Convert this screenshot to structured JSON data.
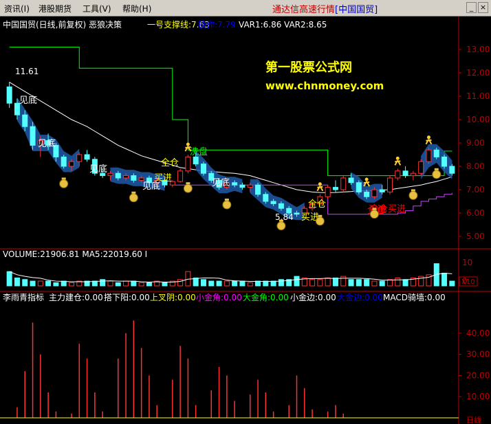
{
  "menu": {
    "items": [
      "资讯(I)",
      "港股期货",
      "工具(V)",
      "帮助(H)"
    ],
    "app_title_prefix": "通达信高速行情",
    "app_title_bracket": "[中国国贸]"
  },
  "window_controls": {
    "minimize": "_",
    "close": "×"
  },
  "price_panel": {
    "header": {
      "stock_title": "中国国贸(日线,前复权) 恶狼决策",
      "support_label": "一号支撑线:7.63",
      "operate_label": "操作:7.79",
      "var1_label": "VAR1:6.86",
      "var2_label": "VAR2:8.65"
    },
    "watermark_cn": "第一股票公式网",
    "watermark_url": "www.chnmoney.com",
    "annotations": {
      "price_high_mark": "11.61",
      "price_low_mark": "5.84",
      "signals": [
        {
          "text": "见底",
          "color": "#ffffff"
        },
        {
          "text": "见底",
          "color": "#ffffff"
        },
        {
          "text": "见底",
          "color": "#ffffff"
        },
        {
          "text": "见底",
          "color": "#ffffff"
        },
        {
          "text": "见底",
          "color": "#ffffff"
        },
        {
          "text": "全仓",
          "color": "#ffff00"
        },
        {
          "text": "买进",
          "color": "#ffff00"
        },
        {
          "text": "洗盘",
          "color": "#00ff00"
        },
        {
          "text": "全仓",
          "color": "#ffff00"
        },
        {
          "text": "买进",
          "color": "#ffff00"
        },
        {
          "text": "全仓",
          "color": "#ff0000"
        },
        {
          "text": "买进",
          "color": "#ff0000"
        },
        {
          "text": "全仓买进",
          "color": "#ff0000"
        }
      ]
    },
    "axis_ticks": [
      "13.00",
      "12.00",
      "11.00",
      "10.00",
      "9.00",
      "8.00",
      "7.00",
      "6.00",
      "5.00"
    ]
  },
  "volume_panel": {
    "header": "VOLUME:21906.81  MA5:22019.60 I",
    "axis_ticks": [
      "10",
      "0"
    ],
    "unit_label": "X10"
  },
  "indicator_panel": {
    "header_name": "李雨青指标",
    "items": [
      {
        "text": "主力建仓:0.00",
        "color": "#ffffff"
      },
      {
        "text": "搭下阳:0.00",
        "color": "#ffffff"
      },
      {
        "text": "上叉阴:0.00",
        "color": "#ffff00"
      },
      {
        "text": "小金角:0.00",
        "color": "#ff00ff"
      },
      {
        "text": "大金角:0.00",
        "color": "#00ff00"
      },
      {
        "text": "小金边:0.00",
        "color": "#ffffff"
      },
      {
        "text": "大金边:0.00",
        "color": "#0000ff"
      },
      {
        "text": "MACD骑墙:0.00",
        "color": "#ffffff"
      }
    ],
    "axis_ticks": [
      "40.00",
      "30.00",
      "20.00",
      "10.00"
    ],
    "bottom_label": "日线"
  },
  "chart_data": [
    {
      "type": "candlestick",
      "title": "中国国贸(日线,前复权) 恶狼决策",
      "y_range": [
        4.6,
        13.3
      ],
      "y_ticks": [
        13,
        12,
        11,
        10,
        9,
        8,
        7,
        6,
        5
      ],
      "candles_ohlc": [
        [
          11.4,
          11.61,
          10.5,
          10.7
        ],
        [
          10.7,
          10.9,
          10.0,
          10.2
        ],
        [
          10.2,
          10.4,
          9.5,
          9.7
        ],
        [
          9.7,
          9.9,
          8.7,
          8.9
        ],
        [
          8.9,
          9.3,
          8.4,
          9.1
        ],
        [
          9.1,
          9.4,
          8.7,
          8.9
        ],
        [
          8.9,
          9.0,
          8.2,
          8.4
        ],
        [
          8.4,
          8.5,
          7.9,
          8.0
        ],
        [
          8.0,
          8.3,
          7.8,
          8.2
        ],
        [
          8.2,
          8.6,
          8.0,
          8.5
        ],
        [
          8.5,
          8.7,
          8.2,
          8.3
        ],
        [
          8.3,
          8.4,
          7.6,
          7.7
        ],
        [
          7.7,
          7.9,
          7.5,
          7.6
        ],
        [
          7.6,
          7.8,
          7.4,
          7.7
        ],
        [
          7.7,
          7.8,
          7.4,
          7.5
        ],
        [
          7.5,
          7.7,
          7.4,
          7.6
        ],
        [
          7.6,
          7.7,
          7.3,
          7.4
        ],
        [
          7.4,
          7.6,
          7.3,
          7.5
        ],
        [
          7.5,
          7.6,
          7.2,
          7.3
        ],
        [
          7.3,
          7.5,
          7.2,
          7.4
        ],
        [
          7.4,
          7.5,
          7.1,
          7.2
        ],
        [
          7.2,
          7.4,
          7.1,
          7.35
        ],
        [
          7.35,
          7.9,
          7.3,
          7.8
        ],
        [
          7.8,
          8.5,
          7.7,
          8.4
        ],
        [
          8.4,
          8.6,
          8.0,
          8.1
        ],
        [
          8.1,
          8.2,
          7.6,
          7.7
        ],
        [
          7.7,
          7.8,
          7.3,
          7.4
        ],
        [
          7.4,
          7.5,
          7.0,
          7.1
        ],
        [
          7.1,
          7.4,
          7.0,
          7.3
        ],
        [
          7.3,
          7.4,
          7.1,
          7.2
        ],
        [
          7.2,
          7.3,
          7.0,
          7.1
        ],
        [
          7.1,
          7.3,
          6.9,
          7.2
        ],
        [
          7.2,
          7.3,
          6.7,
          6.8
        ],
        [
          6.8,
          6.9,
          6.4,
          6.5
        ],
        [
          6.5,
          6.6,
          6.3,
          6.4
        ],
        [
          6.4,
          6.5,
          6.1,
          6.2
        ],
        [
          6.2,
          6.3,
          5.9,
          6.0
        ],
        [
          6.0,
          6.1,
          5.84,
          5.95
        ],
        [
          5.95,
          6.3,
          5.9,
          6.2
        ],
        [
          6.2,
          6.5,
          6.1,
          6.4
        ],
        [
          6.4,
          6.8,
          6.3,
          6.7
        ],
        [
          6.7,
          7.2,
          6.6,
          7.1
        ],
        [
          7.1,
          7.4,
          6.9,
          7.0
        ],
        [
          7.0,
          7.6,
          6.9,
          7.5
        ],
        [
          7.5,
          7.7,
          7.2,
          7.3
        ],
        [
          7.3,
          7.4,
          6.8,
          6.9
        ],
        [
          6.9,
          7.0,
          6.6,
          6.7
        ],
        [
          6.7,
          7.1,
          6.6,
          7.0
        ],
        [
          7.0,
          7.2,
          6.8,
          6.9
        ],
        [
          6.9,
          7.6,
          6.8,
          7.5
        ],
        [
          7.5,
          7.9,
          7.4,
          7.8
        ],
        [
          7.8,
          8.0,
          7.5,
          7.6
        ],
        [
          7.6,
          7.8,
          7.4,
          7.7
        ],
        [
          7.7,
          8.3,
          7.6,
          8.2
        ],
        [
          8.2,
          8.8,
          8.1,
          8.7
        ],
        [
          8.7,
          8.8,
          8.3,
          8.4
        ],
        [
          8.4,
          8.5,
          7.9,
          8.0
        ],
        [
          8.0,
          8.1,
          7.6,
          7.7
        ]
      ],
      "series": [
        {
          "name": "一号支撑线",
          "color": "#00ff00",
          "values": [
            13.1,
            13.1,
            13.1,
            13.1,
            13.1,
            13.1,
            13.1,
            13.1,
            13.1,
            12.2,
            12.2,
            12.2,
            12.2,
            12.2,
            12.2,
            12.2,
            12.2,
            12.2,
            12.2,
            12.2,
            12.2,
            10.0,
            10.0,
            8.7,
            8.7,
            8.7,
            8.7,
            8.7,
            8.7,
            8.7,
            8.7,
            8.7,
            8.7,
            8.7,
            8.7,
            8.7,
            8.7,
            8.7,
            8.7,
            8.7,
            8.7,
            7.6,
            7.6,
            7.6,
            7.6,
            7.6,
            7.6,
            7.6,
            7.6,
            7.6,
            7.6,
            7.6,
            7.6,
            7.6,
            7.6,
            7.6,
            8.65,
            8.65
          ]
        },
        {
          "name": "white MA",
          "color": "#ffffff",
          "values": [
            11.6,
            11.4,
            11.2,
            11.0,
            10.8,
            10.6,
            10.4,
            10.2,
            10.0,
            9.85,
            9.7,
            9.5,
            9.3,
            9.1,
            8.9,
            8.75,
            8.6,
            8.45,
            8.35,
            8.25,
            8.15,
            8.05,
            7.95,
            7.9,
            7.85,
            7.8,
            7.78,
            7.75,
            7.72,
            7.7,
            7.65,
            7.6,
            7.5,
            7.4,
            7.3,
            7.2,
            7.1,
            7.0,
            6.95,
            6.9,
            6.88,
            6.87,
            6.88,
            6.9,
            6.92,
            6.95,
            6.96,
            6.97,
            6.98,
            7.0,
            7.05,
            7.1,
            7.15,
            7.2,
            7.28,
            7.35,
            7.45,
            7.55
          ]
        },
        {
          "name": "VAR1",
          "color": "#cc44ff",
          "values": [
            null,
            null,
            null,
            null,
            null,
            null,
            null,
            null,
            null,
            null,
            null,
            null,
            null,
            null,
            null,
            null,
            null,
            null,
            null,
            null,
            null,
            7.2,
            7.2,
            7.2,
            7.2,
            7.2,
            7.2,
            7.2,
            7.2,
            7.2,
            7.2,
            7.2,
            7.2,
            7.2,
            7.2,
            7.2,
            7.2,
            7.2,
            7.2,
            7.2,
            7.2,
            5.95,
            5.95,
            5.95,
            5.95,
            5.95,
            5.95,
            5.95,
            5.95,
            5.95,
            6.0,
            6.1,
            6.3,
            6.5,
            6.6,
            6.7,
            6.8,
            6.86
          ]
        }
      ]
    },
    {
      "type": "bar",
      "title": "VOLUME",
      "y_range": [
        0,
        16
      ],
      "values": [
        9,
        5,
        4,
        3,
        3,
        3,
        2,
        3,
        2,
        3,
        3,
        3,
        4,
        3,
        2,
        3,
        3,
        2,
        2,
        3,
        2,
        3,
        4,
        9,
        5,
        4,
        3,
        3,
        3,
        3,
        3,
        2,
        3,
        3,
        3,
        4,
        4,
        6,
        5,
        4,
        4,
        5,
        5,
        6,
        4,
        4,
        4,
        3,
        3,
        4,
        5,
        4,
        5,
        6,
        7,
        14,
        8,
        3
      ]
    },
    {
      "type": "bar",
      "title": "李雨青指标",
      "y_range": [
        0,
        50
      ],
      "y_ticks": [
        40,
        30,
        20,
        10
      ],
      "values": [
        0,
        5,
        22,
        45,
        30,
        12,
        3,
        0,
        2,
        35,
        28,
        12,
        3,
        0,
        28,
        40,
        46,
        33,
        20,
        6,
        0,
        18,
        34,
        28,
        6,
        0,
        13,
        24,
        20,
        8,
        0,
        11,
        18,
        12,
        3,
        0,
        6,
        20,
        14,
        4,
        0,
        3,
        6,
        2,
        0,
        0,
        0,
        0,
        0,
        0,
        0,
        0,
        0,
        0,
        0,
        0,
        0,
        0
      ]
    }
  ]
}
